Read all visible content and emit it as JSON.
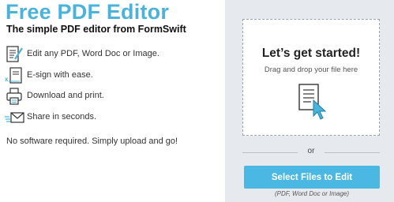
{
  "header": {
    "title": "Free PDF Editor",
    "subtitle": "The simple PDF editor from FormSwift"
  },
  "features": [
    {
      "icon": "edit-document-icon",
      "label": "Edit any PDF, Word Doc or Image."
    },
    {
      "icon": "esign-icon",
      "label": "E-sign with ease."
    },
    {
      "icon": "printer-icon",
      "label": "Download and print."
    },
    {
      "icon": "send-mail-icon",
      "label": "Share in seconds."
    }
  ],
  "note": "No software required. Simply upload and go!",
  "upload": {
    "heading": "Let’s get started!",
    "instructions": "Drag and drop your file here",
    "icon": "document-cursor-icon",
    "divider_text": "or",
    "button_label": "Select Files to Edit",
    "formats_hint": "(PDF, Word Doc or Image)"
  },
  "colors": {
    "accent": "#4ab3dc",
    "button": "#4ab8e3",
    "panel": "#e6eaee"
  }
}
